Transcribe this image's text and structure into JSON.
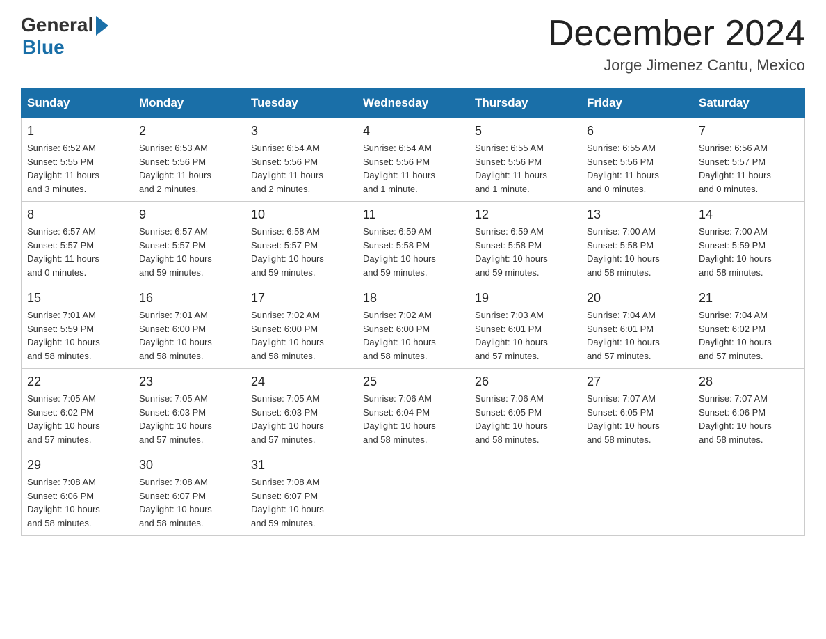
{
  "logo": {
    "general": "General",
    "blue": "Blue"
  },
  "title": "December 2024",
  "subtitle": "Jorge Jimenez Cantu, Mexico",
  "days_header": [
    "Sunday",
    "Monday",
    "Tuesday",
    "Wednesday",
    "Thursday",
    "Friday",
    "Saturday"
  ],
  "weeks": [
    [
      {
        "day": "1",
        "info": "Sunrise: 6:52 AM\nSunset: 5:55 PM\nDaylight: 11 hours\nand 3 minutes."
      },
      {
        "day": "2",
        "info": "Sunrise: 6:53 AM\nSunset: 5:56 PM\nDaylight: 11 hours\nand 2 minutes."
      },
      {
        "day": "3",
        "info": "Sunrise: 6:54 AM\nSunset: 5:56 PM\nDaylight: 11 hours\nand 2 minutes."
      },
      {
        "day": "4",
        "info": "Sunrise: 6:54 AM\nSunset: 5:56 PM\nDaylight: 11 hours\nand 1 minute."
      },
      {
        "day": "5",
        "info": "Sunrise: 6:55 AM\nSunset: 5:56 PM\nDaylight: 11 hours\nand 1 minute."
      },
      {
        "day": "6",
        "info": "Sunrise: 6:55 AM\nSunset: 5:56 PM\nDaylight: 11 hours\nand 0 minutes."
      },
      {
        "day": "7",
        "info": "Sunrise: 6:56 AM\nSunset: 5:57 PM\nDaylight: 11 hours\nand 0 minutes."
      }
    ],
    [
      {
        "day": "8",
        "info": "Sunrise: 6:57 AM\nSunset: 5:57 PM\nDaylight: 11 hours\nand 0 minutes."
      },
      {
        "day": "9",
        "info": "Sunrise: 6:57 AM\nSunset: 5:57 PM\nDaylight: 10 hours\nand 59 minutes."
      },
      {
        "day": "10",
        "info": "Sunrise: 6:58 AM\nSunset: 5:57 PM\nDaylight: 10 hours\nand 59 minutes."
      },
      {
        "day": "11",
        "info": "Sunrise: 6:59 AM\nSunset: 5:58 PM\nDaylight: 10 hours\nand 59 minutes."
      },
      {
        "day": "12",
        "info": "Sunrise: 6:59 AM\nSunset: 5:58 PM\nDaylight: 10 hours\nand 59 minutes."
      },
      {
        "day": "13",
        "info": "Sunrise: 7:00 AM\nSunset: 5:58 PM\nDaylight: 10 hours\nand 58 minutes."
      },
      {
        "day": "14",
        "info": "Sunrise: 7:00 AM\nSunset: 5:59 PM\nDaylight: 10 hours\nand 58 minutes."
      }
    ],
    [
      {
        "day": "15",
        "info": "Sunrise: 7:01 AM\nSunset: 5:59 PM\nDaylight: 10 hours\nand 58 minutes."
      },
      {
        "day": "16",
        "info": "Sunrise: 7:01 AM\nSunset: 6:00 PM\nDaylight: 10 hours\nand 58 minutes."
      },
      {
        "day": "17",
        "info": "Sunrise: 7:02 AM\nSunset: 6:00 PM\nDaylight: 10 hours\nand 58 minutes."
      },
      {
        "day": "18",
        "info": "Sunrise: 7:02 AM\nSunset: 6:00 PM\nDaylight: 10 hours\nand 58 minutes."
      },
      {
        "day": "19",
        "info": "Sunrise: 7:03 AM\nSunset: 6:01 PM\nDaylight: 10 hours\nand 57 minutes."
      },
      {
        "day": "20",
        "info": "Sunrise: 7:04 AM\nSunset: 6:01 PM\nDaylight: 10 hours\nand 57 minutes."
      },
      {
        "day": "21",
        "info": "Sunrise: 7:04 AM\nSunset: 6:02 PM\nDaylight: 10 hours\nand 57 minutes."
      }
    ],
    [
      {
        "day": "22",
        "info": "Sunrise: 7:05 AM\nSunset: 6:02 PM\nDaylight: 10 hours\nand 57 minutes."
      },
      {
        "day": "23",
        "info": "Sunrise: 7:05 AM\nSunset: 6:03 PM\nDaylight: 10 hours\nand 57 minutes."
      },
      {
        "day": "24",
        "info": "Sunrise: 7:05 AM\nSunset: 6:03 PM\nDaylight: 10 hours\nand 57 minutes."
      },
      {
        "day": "25",
        "info": "Sunrise: 7:06 AM\nSunset: 6:04 PM\nDaylight: 10 hours\nand 58 minutes."
      },
      {
        "day": "26",
        "info": "Sunrise: 7:06 AM\nSunset: 6:05 PM\nDaylight: 10 hours\nand 58 minutes."
      },
      {
        "day": "27",
        "info": "Sunrise: 7:07 AM\nSunset: 6:05 PM\nDaylight: 10 hours\nand 58 minutes."
      },
      {
        "day": "28",
        "info": "Sunrise: 7:07 AM\nSunset: 6:06 PM\nDaylight: 10 hours\nand 58 minutes."
      }
    ],
    [
      {
        "day": "29",
        "info": "Sunrise: 7:08 AM\nSunset: 6:06 PM\nDaylight: 10 hours\nand 58 minutes."
      },
      {
        "day": "30",
        "info": "Sunrise: 7:08 AM\nSunset: 6:07 PM\nDaylight: 10 hours\nand 58 minutes."
      },
      {
        "day": "31",
        "info": "Sunrise: 7:08 AM\nSunset: 6:07 PM\nDaylight: 10 hours\nand 59 minutes."
      },
      {
        "day": "",
        "info": ""
      },
      {
        "day": "",
        "info": ""
      },
      {
        "day": "",
        "info": ""
      },
      {
        "day": "",
        "info": ""
      }
    ]
  ]
}
